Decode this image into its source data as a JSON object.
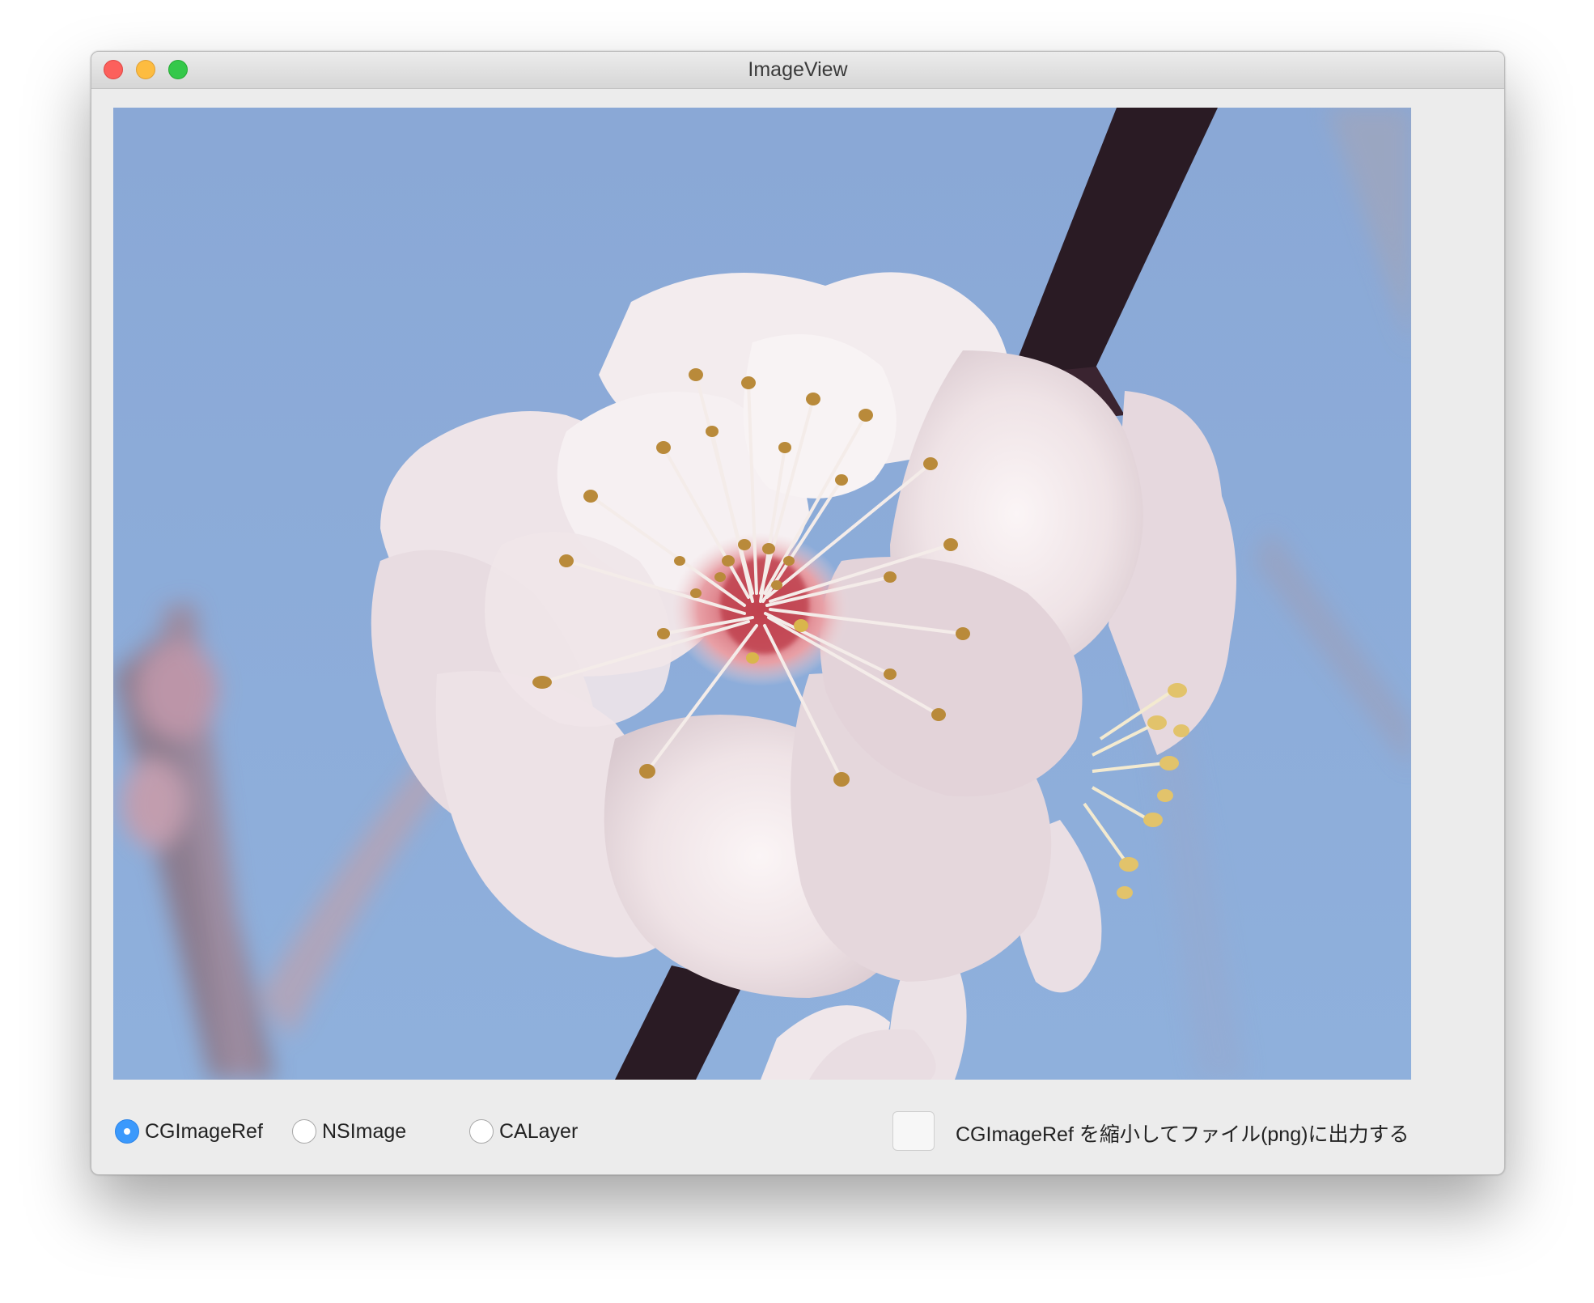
{
  "window": {
    "title": "ImageView"
  },
  "image": {
    "subject": "plum-blossom-photo"
  },
  "render_mode": {
    "options": [
      {
        "label": "CGImageRef",
        "selected": true
      },
      {
        "label": "NSImage",
        "selected": false
      },
      {
        "label": "CALayer",
        "selected": false
      }
    ]
  },
  "export": {
    "label": "CGImageRef を縮小してファイル(png)に出力する",
    "checked": false
  },
  "colors": {
    "accent": "#3b99fc",
    "window_bg": "#ececec",
    "sky": "#8fabd6"
  }
}
